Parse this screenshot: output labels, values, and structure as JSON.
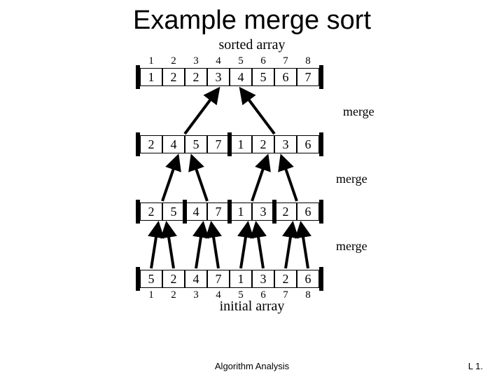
{
  "title": "Example merge sort",
  "top_label": "sorted array",
  "bottom_label": "initial array",
  "merge_label": "merge",
  "indices": [
    "1",
    "2",
    "3",
    "4",
    "5",
    "6",
    "7",
    "8"
  ],
  "rows": {
    "r1": [
      "1",
      "2",
      "2",
      "3",
      "4",
      "5",
      "6",
      "7"
    ],
    "r2": [
      "2",
      "4",
      "5",
      "7",
      "1",
      "2",
      "3",
      "6"
    ],
    "r3": [
      "2",
      "5",
      "4",
      "7",
      "1",
      "3",
      "2",
      "6"
    ],
    "r4": [
      "5",
      "2",
      "4",
      "7",
      "1",
      "3",
      "2",
      "6"
    ]
  },
  "footer_left": "Algorithm Analysis",
  "footer_right": "L 1."
}
